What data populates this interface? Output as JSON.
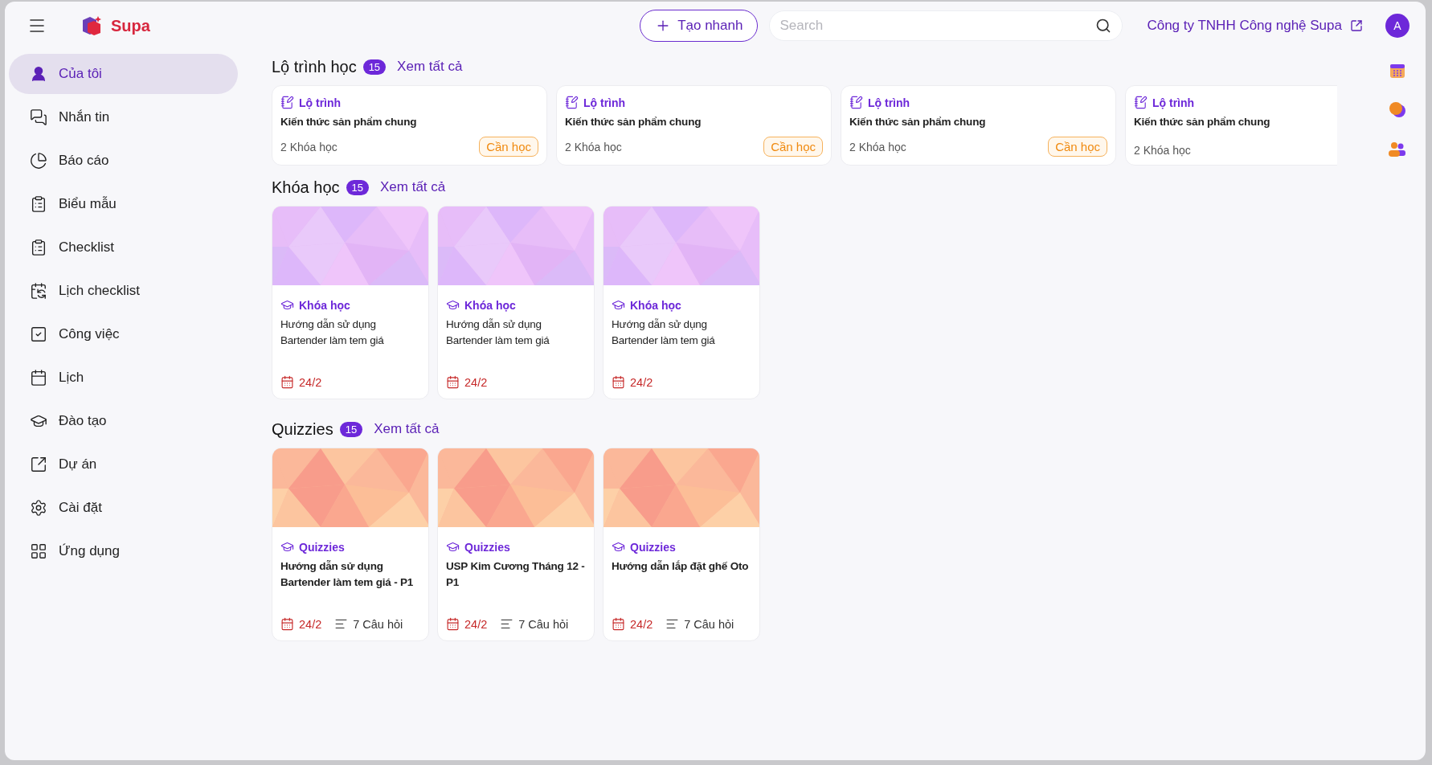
{
  "header": {
    "brand": "Supa",
    "quick_create": "Tạo nhanh",
    "search": {
      "placeholder": "Search"
    },
    "company": "Công ty TNHH Công nghệ Supa",
    "avatar": "A"
  },
  "sidebar": {
    "items": [
      {
        "label": "Của tôi",
        "selected": true
      },
      {
        "label": "Nhắn tin",
        "selected": false
      },
      {
        "label": "Báo cáo",
        "selected": false
      },
      {
        "label": "Biểu mẫu",
        "selected": false
      },
      {
        "label": "Checklist",
        "selected": false
      },
      {
        "label": "Lịch checklist",
        "selected": false
      },
      {
        "label": "Công việc",
        "selected": false
      },
      {
        "label": "Lịch",
        "selected": false
      },
      {
        "label": "Đào tạo",
        "selected": false
      },
      {
        "label": "Dự án",
        "selected": false
      },
      {
        "label": "Cài đặt",
        "selected": false
      },
      {
        "label": "Ứng dụng",
        "selected": false
      }
    ]
  },
  "learning_paths": {
    "title": "Lộ trình học",
    "count": "15",
    "see_all": "Xem tất cả",
    "cards": [
      {
        "type": "Lộ trình",
        "title": "Kiến thức sản phẩm chung",
        "courses": "2 Khóa học",
        "badge": "Cần học"
      },
      {
        "type": "Lộ trình",
        "title": "Kiến thức sản phẩm chung",
        "courses": "2 Khóa học",
        "badge": "Cần học"
      },
      {
        "type": "Lộ trình",
        "title": "Kiến thức sản phẩm chung",
        "courses": "2 Khóa học",
        "badge": "Cần học"
      },
      {
        "type": "Lộ trình",
        "title": "Kiến thức sản phẩm chung",
        "courses": "2 Khóa học"
      }
    ]
  },
  "sections": [
    {
      "kind": "course",
      "title": "Khóa học",
      "count": "15",
      "see_all": "Xem tất cả",
      "cards": [
        {
          "type": "Khóa học",
          "title": "Hướng dẫn sử dụng Bartender làm tem giá",
          "date": "24/2"
        },
        {
          "type": "Khóa học",
          "title": "Hướng dẫn sử dụng Bartender làm tem giá",
          "date": "24/2"
        },
        {
          "type": "Khóa học",
          "title": "Hướng dẫn sử dụng Bartender làm tem giá",
          "date": "24/2"
        }
      ]
    },
    {
      "kind": "quiz",
      "title": "Quizzies",
      "count": "15",
      "see_all": "Xem tất cả",
      "cards": [
        {
          "type": "Quizzies",
          "title": "Hướng dẫn sử dụng Bartender làm tem giá - P1",
          "date": "24/2",
          "questions": "7 Câu hỏi"
        },
        {
          "type": "Quizzies",
          "title": "USP Kim Cương Tháng 12 - P1",
          "date": "24/2",
          "questions": "7 Câu hỏi"
        },
        {
          "type": "Quizzies",
          "title": "Hướng dẫn lắp đặt ghế Oto",
          "date": "24/2",
          "questions": "7 Câu hỏi"
        }
      ]
    }
  ]
}
